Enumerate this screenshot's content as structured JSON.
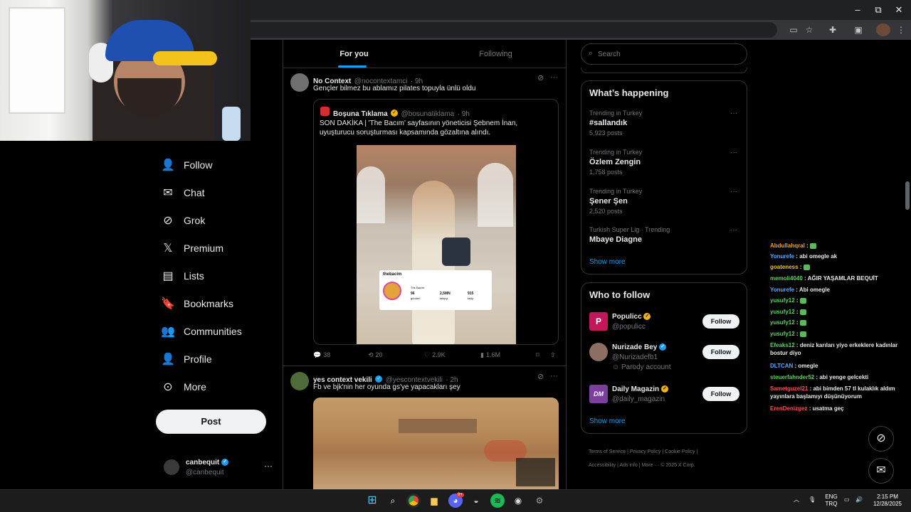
{
  "browser": {
    "controls": {
      "minimize": "–",
      "restore": "⧉",
      "close": "✕"
    }
  },
  "nav": {
    "items": [
      {
        "label": "Follow",
        "icon": "follow-icon"
      },
      {
        "label": "Chat",
        "icon": "chat-icon"
      },
      {
        "label": "Grok",
        "icon": "grok-icon"
      },
      {
        "label": "Premium",
        "icon": "x-logo-icon"
      },
      {
        "label": "Lists",
        "icon": "lists-icon"
      },
      {
        "label": "Bookmarks",
        "icon": "bookmark-icon"
      },
      {
        "label": "Communities",
        "icon": "communities-icon"
      },
      {
        "label": "Profile",
        "icon": "profile-icon"
      },
      {
        "label": "More",
        "icon": "more-icon"
      }
    ],
    "post_label": "Post",
    "account": {
      "name": "canbequit",
      "handle": "@canbequit"
    }
  },
  "feed": {
    "tabs": [
      {
        "label": "For you",
        "active": true
      },
      {
        "label": "Following",
        "active": false
      }
    ],
    "tweet1": {
      "name": "No Context",
      "handle": "@nocontextamci",
      "time": "· 9h",
      "text": "Gençler bilmez bu ablamız pilates topuyla ünlü oldu",
      "quote": {
        "name": "Boşuna Tıklama",
        "handle": "@bosunatiklama",
        "time": "· 9h",
        "text": "SON DAKİKA | 'The Bacım' sayfasının yöneticisi Şebnem İnan, uyuşturucu soruşturması kapsamında gözaltına alındı.",
        "profile_card": {
          "username": "thebacim",
          "display": "The Bacım",
          "stats": [
            {
              "value": "96",
              "label": "gönderi"
            },
            {
              "value": "2,5MN",
              "label": "takipçi"
            },
            {
              "value": "915",
              "label": "takip"
            }
          ]
        }
      },
      "stats": {
        "replies": "38",
        "reposts": "20",
        "likes": "2.9K",
        "views": "1.6M"
      }
    },
    "tweet2": {
      "name": "yes context vekili",
      "handle": "@yescontextvekili",
      "time": "· 2h",
      "text": "Fb ve bjk'nin her oyunda gs'ye yapacakları şey"
    }
  },
  "right": {
    "search_placeholder": "Search",
    "happening_title": "What’s happening",
    "trends": [
      {
        "context": "Trending in Turkey",
        "name": "#sallandık",
        "count": "5,923 posts"
      },
      {
        "context": "Trending in Turkey",
        "name": "Özlem Zengin",
        "count": "1,758 posts"
      },
      {
        "context": "Trending in Turkey",
        "name": "Şener Şen",
        "count": "2,520 posts"
      },
      {
        "context": "Turkish Super Lig · Trending",
        "name": "Mbaye Diagne",
        "count": ""
      }
    ],
    "show_more": "Show more",
    "who_title": "Who to follow",
    "who": [
      {
        "name": "Populicc",
        "handle": "@populicc",
        "extra": "",
        "color": "#c2185b",
        "initial": "P"
      },
      {
        "name": "Nurizade Bey",
        "handle": "@Nurizadefb1",
        "extra": "Parody account",
        "color": "#8d6e63",
        "initial": ""
      },
      {
        "name": "Daily Magazin",
        "handle": "@daily_magazin",
        "extra": "",
        "color": "#7b3fa0",
        "initial": "DM"
      }
    ],
    "follow_label": "Follow",
    "footer": [
      "Terms of Service",
      "Privacy Policy",
      "Cookie Policy",
      "Accessibility",
      "Ads info",
      "More ···",
      "© 2025 X Corp."
    ]
  },
  "chat": [
    {
      "user": "Abdullahqral",
      "color": "#f0a030",
      "msg": "",
      "emote": true
    },
    {
      "user": "Yonurefe",
      "color": "#5aa9ff",
      "msg": "abi omegle ak",
      "emote": false
    },
    {
      "user": "goateness",
      "color": "#f0c020",
      "msg": "",
      "emote": true
    },
    {
      "user": "memoli4040",
      "color": "#5fd35f",
      "msg": "AĞIR YAŞAMLAR BEQUİT",
      "emote": false
    },
    {
      "user": "Yonurefe",
      "color": "#5aa9ff",
      "msg": "Abi omegle",
      "emote": false
    },
    {
      "user": "yusufy12",
      "color": "#5fd35f",
      "msg": "",
      "emote": true
    },
    {
      "user": "yusufy12",
      "color": "#5fd35f",
      "msg": "",
      "emote": true
    },
    {
      "user": "yusufy12",
      "color": "#5fd35f",
      "msg": "",
      "emote": true
    },
    {
      "user": "yusufy12",
      "color": "#5fd35f",
      "msg": "",
      "emote": true
    },
    {
      "user": "Efeaks12",
      "color": "#5fd35f",
      "msg": "deniz karıları yiyo erkeklere kadınlar bostur diyo",
      "emote": false
    },
    {
      "user": "DLTCAN",
      "color": "#5aa9ff",
      "msg": "omegle",
      "emote": false
    },
    {
      "user": "steuerfahnder52",
      "color": "#5fd35f",
      "msg": "abi yenge gelcekti",
      "emote": false
    },
    {
      "user": "Sametguzel21",
      "color": "#ff4f4f",
      "msg": "abi bimden 57 tl kulaklık aldım yayınlara başlamıyı düşünüyorum",
      "emote": false
    },
    {
      "user": "ErenDenizgez",
      "color": "#ff4f4f",
      "msg": "usatma geç",
      "emote": false
    }
  ],
  "taskbar": {
    "lang_top": "ENG",
    "lang_bottom": "TRQ",
    "time": "2:15 PM",
    "date": "12/28/2025",
    "discord_badge": "9+"
  }
}
